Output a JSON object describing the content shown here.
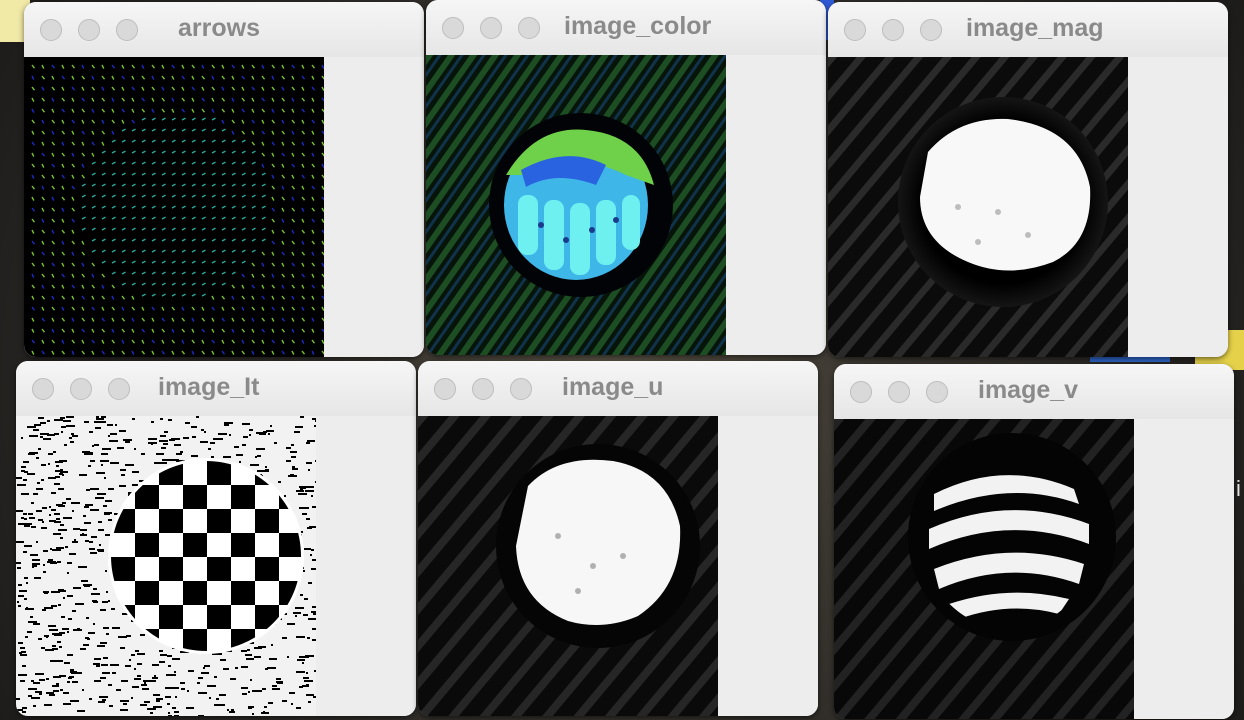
{
  "windows": {
    "arrows": {
      "title": "arrows"
    },
    "image_color": {
      "title": "image_color"
    },
    "image_mag": {
      "title": "image_mag"
    },
    "image_lt": {
      "title": "image_It"
    },
    "image_u": {
      "title": "image_u"
    },
    "image_v": {
      "title": "image_v"
    }
  },
  "colors": {
    "window_bg": "#ececec",
    "title_text": "#8a8a8a",
    "traffic_light": "#d9d9d9",
    "arrow_green": "#7ac42a",
    "arrow_teal": "#2ba89a",
    "arrow_blue": "#1c2cc8"
  },
  "desktop": {
    "edge_text": "i"
  }
}
